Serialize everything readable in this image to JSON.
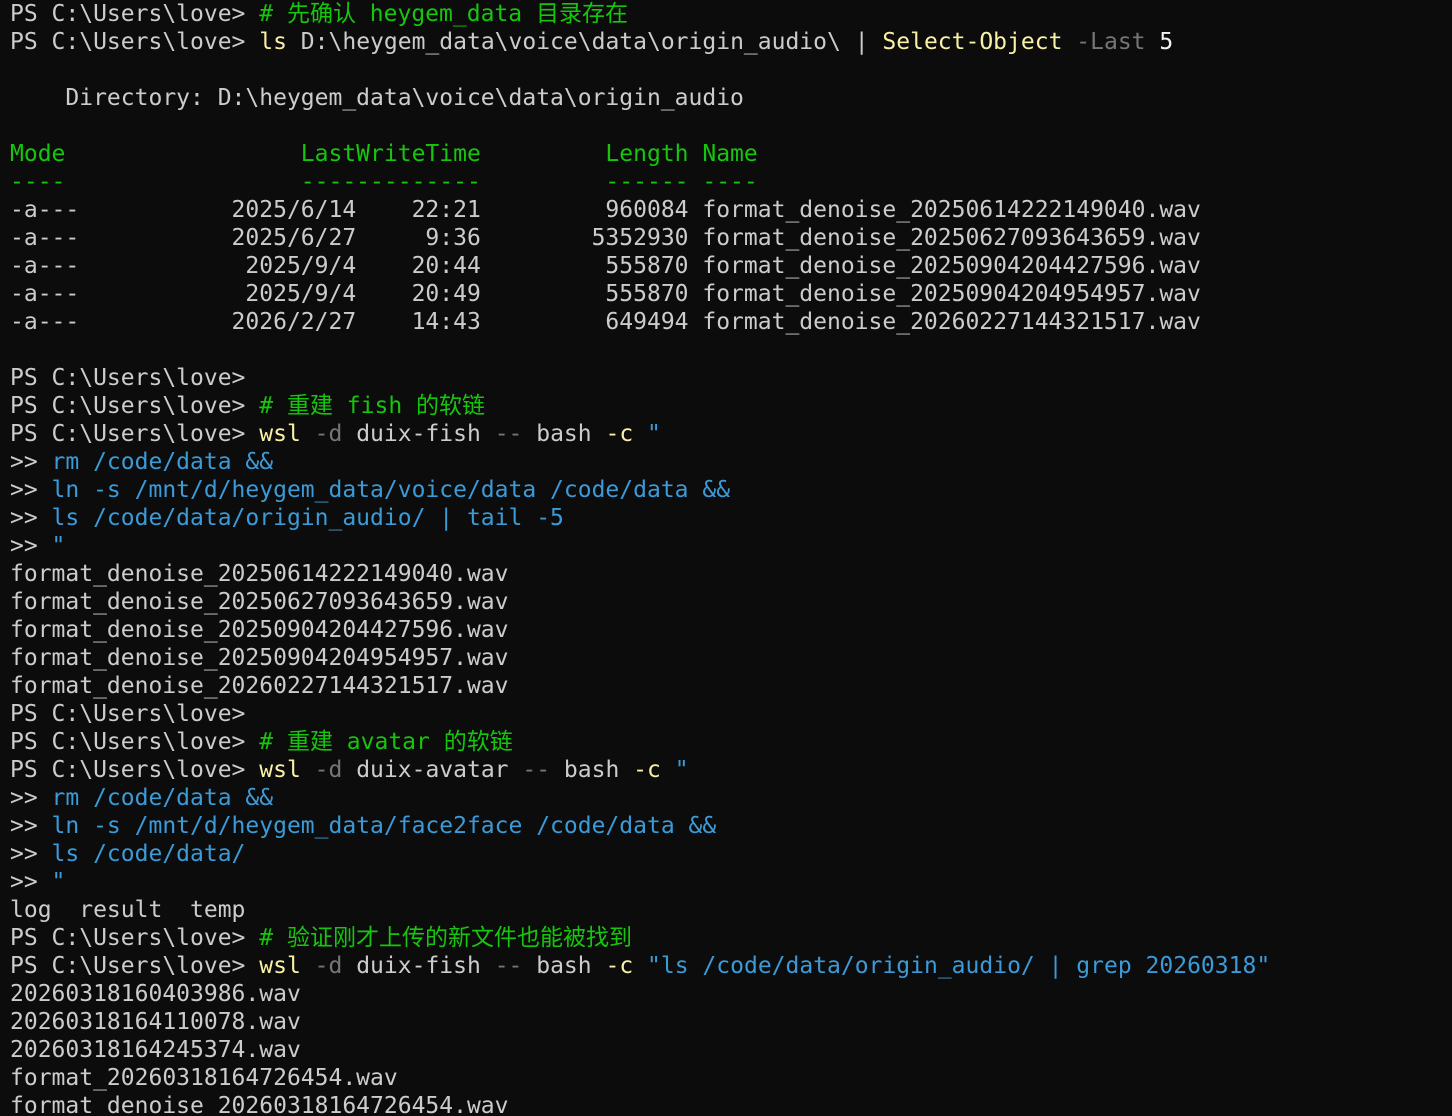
{
  "window": {
    "background": "#0c0c0c",
    "foreground": "#cccccc"
  },
  "colors": {
    "def": "#cccccc",
    "green": "#16c60c",
    "yellow": "#f9f1a5",
    "gray": "#767676",
    "blue": "#3b9ad8",
    "white": "#f2f2f2"
  },
  "lines": [
    {
      "kind": "prompt",
      "segments": [
        {
          "t": "PS C:\\Users\\love> ",
          "c": "def"
        },
        {
          "t": "# 先确认 heygem_data 目录存在",
          "c": "green"
        }
      ]
    },
    {
      "kind": "prompt",
      "segments": [
        {
          "t": "PS C:\\Users\\love> ",
          "c": "def"
        },
        {
          "t": "ls",
          "c": "yellow"
        },
        {
          "t": " D:\\heygem_data\\voice\\data\\origin_audio\\ ",
          "c": "def"
        },
        {
          "t": "|",
          "c": "def"
        },
        {
          "t": " ",
          "c": "def"
        },
        {
          "t": "Select-Object",
          "c": "yellow"
        },
        {
          "t": " ",
          "c": "def"
        },
        {
          "t": "-Last",
          "c": "gray"
        },
        {
          "t": " ",
          "c": "def"
        },
        {
          "t": "5",
          "c": "white"
        }
      ]
    },
    {
      "kind": "blank",
      "segments": []
    },
    {
      "kind": "output",
      "segments": [
        {
          "t": "    Directory: D:\\heygem_data\\voice\\data\\origin_audio",
          "c": "def"
        }
      ]
    },
    {
      "kind": "blank",
      "segments": []
    },
    {
      "kind": "table-header",
      "segments": [
        {
          "t": "Mode                 LastWriteTime         Length Name",
          "c": "green"
        }
      ]
    },
    {
      "kind": "table-header",
      "segments": [
        {
          "t": "----                 -------------         ------ ----",
          "c": "green"
        }
      ]
    },
    {
      "kind": "table-row",
      "segments": [
        {
          "t": "-a---           2025/6/14    22:21         960084 format_denoise_20250614222149040.wav",
          "c": "def"
        }
      ]
    },
    {
      "kind": "table-row",
      "segments": [
        {
          "t": "-a---           2025/6/27     9:36        5352930 format_denoise_20250627093643659.wav",
          "c": "def"
        }
      ]
    },
    {
      "kind": "table-row",
      "segments": [
        {
          "t": "-a---            2025/9/4    20:44         555870 format_denoise_20250904204427596.wav",
          "c": "def"
        }
      ]
    },
    {
      "kind": "table-row",
      "segments": [
        {
          "t": "-a---            2025/9/4    20:49         555870 format_denoise_20250904204954957.wav",
          "c": "def"
        }
      ]
    },
    {
      "kind": "table-row",
      "segments": [
        {
          "t": "-a---           2026/2/27    14:43         649494 format_denoise_20260227144321517.wav",
          "c": "def"
        }
      ]
    },
    {
      "kind": "blank",
      "segments": []
    },
    {
      "kind": "prompt",
      "segments": [
        {
          "t": "PS C:\\Users\\love>",
          "c": "def"
        }
      ]
    },
    {
      "kind": "prompt",
      "segments": [
        {
          "t": "PS C:\\Users\\love> ",
          "c": "def"
        },
        {
          "t": "# 重建 fish 的软链",
          "c": "green"
        }
      ]
    },
    {
      "kind": "prompt",
      "segments": [
        {
          "t": "PS C:\\Users\\love> ",
          "c": "def"
        },
        {
          "t": "wsl",
          "c": "yellow"
        },
        {
          "t": " ",
          "c": "def"
        },
        {
          "t": "-d",
          "c": "gray"
        },
        {
          "t": " duix-fish ",
          "c": "def"
        },
        {
          "t": "--",
          "c": "gray"
        },
        {
          "t": " bash ",
          "c": "def"
        },
        {
          "t": "-c",
          "c": "yellow"
        },
        {
          "t": " ",
          "c": "def"
        },
        {
          "t": "\"",
          "c": "blue"
        }
      ]
    },
    {
      "kind": "continuation",
      "segments": [
        {
          "t": ">> ",
          "c": "def"
        },
        {
          "t": "rm /code/data &&",
          "c": "blue"
        }
      ]
    },
    {
      "kind": "continuation",
      "segments": [
        {
          "t": ">> ",
          "c": "def"
        },
        {
          "t": "ln -s /mnt/d/heygem_data/voice/data /code/data &&",
          "c": "blue"
        }
      ]
    },
    {
      "kind": "continuation",
      "segments": [
        {
          "t": ">> ",
          "c": "def"
        },
        {
          "t": "ls /code/data/origin_audio/ | tail -5",
          "c": "blue"
        }
      ]
    },
    {
      "kind": "continuation",
      "segments": [
        {
          "t": ">> ",
          "c": "def"
        },
        {
          "t": "\"",
          "c": "blue"
        }
      ]
    },
    {
      "kind": "output",
      "segments": [
        {
          "t": "format_denoise_20250614222149040.wav",
          "c": "def"
        }
      ]
    },
    {
      "kind": "output",
      "segments": [
        {
          "t": "format_denoise_20250627093643659.wav",
          "c": "def"
        }
      ]
    },
    {
      "kind": "output",
      "segments": [
        {
          "t": "format_denoise_20250904204427596.wav",
          "c": "def"
        }
      ]
    },
    {
      "kind": "output",
      "segments": [
        {
          "t": "format_denoise_20250904204954957.wav",
          "c": "def"
        }
      ]
    },
    {
      "kind": "output",
      "segments": [
        {
          "t": "format_denoise_20260227144321517.wav",
          "c": "def"
        }
      ]
    },
    {
      "kind": "prompt",
      "segments": [
        {
          "t": "PS C:\\Users\\love>",
          "c": "def"
        }
      ]
    },
    {
      "kind": "prompt",
      "segments": [
        {
          "t": "PS C:\\Users\\love> ",
          "c": "def"
        },
        {
          "t": "# 重建 avatar 的软链",
          "c": "green"
        }
      ]
    },
    {
      "kind": "prompt",
      "segments": [
        {
          "t": "PS C:\\Users\\love> ",
          "c": "def"
        },
        {
          "t": "wsl",
          "c": "yellow"
        },
        {
          "t": " ",
          "c": "def"
        },
        {
          "t": "-d",
          "c": "gray"
        },
        {
          "t": " duix-avatar ",
          "c": "def"
        },
        {
          "t": "--",
          "c": "gray"
        },
        {
          "t": " bash ",
          "c": "def"
        },
        {
          "t": "-c",
          "c": "yellow"
        },
        {
          "t": " ",
          "c": "def"
        },
        {
          "t": "\"",
          "c": "blue"
        }
      ]
    },
    {
      "kind": "continuation",
      "segments": [
        {
          "t": ">> ",
          "c": "def"
        },
        {
          "t": "rm /code/data &&",
          "c": "blue"
        }
      ]
    },
    {
      "kind": "continuation",
      "segments": [
        {
          "t": ">> ",
          "c": "def"
        },
        {
          "t": "ln -s /mnt/d/heygem_data/face2face /code/data &&",
          "c": "blue"
        }
      ]
    },
    {
      "kind": "continuation",
      "segments": [
        {
          "t": ">> ",
          "c": "def"
        },
        {
          "t": "ls /code/data/",
          "c": "blue"
        }
      ]
    },
    {
      "kind": "continuation",
      "segments": [
        {
          "t": ">> ",
          "c": "def"
        },
        {
          "t": "\"",
          "c": "blue"
        }
      ]
    },
    {
      "kind": "output",
      "segments": [
        {
          "t": "log  result  temp",
          "c": "def"
        }
      ]
    },
    {
      "kind": "prompt",
      "segments": [
        {
          "t": "PS C:\\Users\\love> ",
          "c": "def"
        },
        {
          "t": "# 验证刚才上传的新文件也能被找到",
          "c": "green"
        }
      ]
    },
    {
      "kind": "prompt",
      "segments": [
        {
          "t": "PS C:\\Users\\love> ",
          "c": "def"
        },
        {
          "t": "wsl",
          "c": "yellow"
        },
        {
          "t": " ",
          "c": "def"
        },
        {
          "t": "-d",
          "c": "gray"
        },
        {
          "t": " duix-fish ",
          "c": "def"
        },
        {
          "t": "--",
          "c": "gray"
        },
        {
          "t": " bash ",
          "c": "def"
        },
        {
          "t": "-c",
          "c": "yellow"
        },
        {
          "t": " ",
          "c": "def"
        },
        {
          "t": "\"ls /code/data/origin_audio/ | grep 20260318\"",
          "c": "blue"
        }
      ]
    },
    {
      "kind": "output",
      "segments": [
        {
          "t": "20260318160403986.wav",
          "c": "def"
        }
      ]
    },
    {
      "kind": "output",
      "segments": [
        {
          "t": "20260318164110078.wav",
          "c": "def"
        }
      ]
    },
    {
      "kind": "output",
      "segments": [
        {
          "t": "20260318164245374.wav",
          "c": "def"
        }
      ]
    },
    {
      "kind": "output",
      "segments": [
        {
          "t": "format_20260318164726454.wav",
          "c": "def"
        }
      ]
    },
    {
      "kind": "output",
      "segments": [
        {
          "t": "format_denoise_20260318164726454.wav",
          "c": "def"
        }
      ]
    }
  ]
}
